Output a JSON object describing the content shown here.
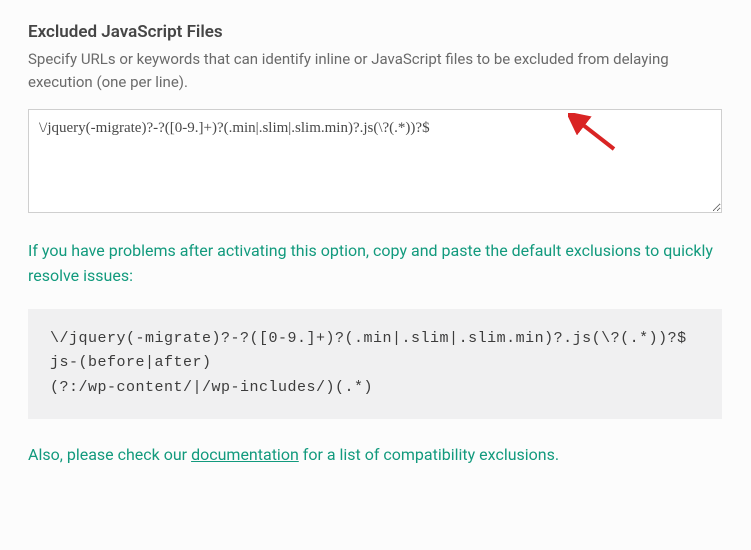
{
  "section": {
    "title": "Excluded JavaScript Files",
    "description": "Specify URLs or keywords that can identify inline or JavaScript files to be excluded from delaying execution (one per line)."
  },
  "textarea": {
    "value": "\\/jquery(-migrate)?-?([0-9.]+)?(.min|.slim|.slim.min)?.js(\\?(.*))?$"
  },
  "hint": {
    "text": "If you have problems after activating this option, copy and paste the default exclusions to quickly resolve issues:"
  },
  "code": {
    "lines": [
      "\\/jquery(-migrate)?-?([0-9.]+)?(.min|.slim|.slim.min)?.js(\\?(.*))?$",
      "js-(before|after)",
      "(?:/wp-content/|/wp-includes/)(.*)"
    ]
  },
  "footer": {
    "prefix": "Also, please check our ",
    "link": "documentation",
    "suffix": " for a list of compatibility exclusions."
  }
}
